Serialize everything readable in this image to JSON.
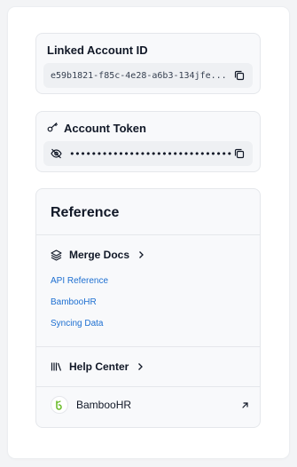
{
  "linked_account": {
    "title": "Linked Account ID",
    "id_value": "e59b1821-f85c-4e28-a6b3-134jfe..."
  },
  "account_token": {
    "title": "Account Token",
    "masked_value": "••••••••••••••••••••••••••••••"
  },
  "reference": {
    "title": "Reference",
    "merge_docs": {
      "label": "Merge Docs",
      "links": [
        "API Reference",
        "BambooHR",
        "Syncing Data"
      ]
    },
    "help_center": {
      "label": "Help Center"
    },
    "integration": {
      "label": "BambooHR"
    }
  },
  "colors": {
    "link": "#1d6fd1",
    "brand_green": "#6dbd2c"
  }
}
